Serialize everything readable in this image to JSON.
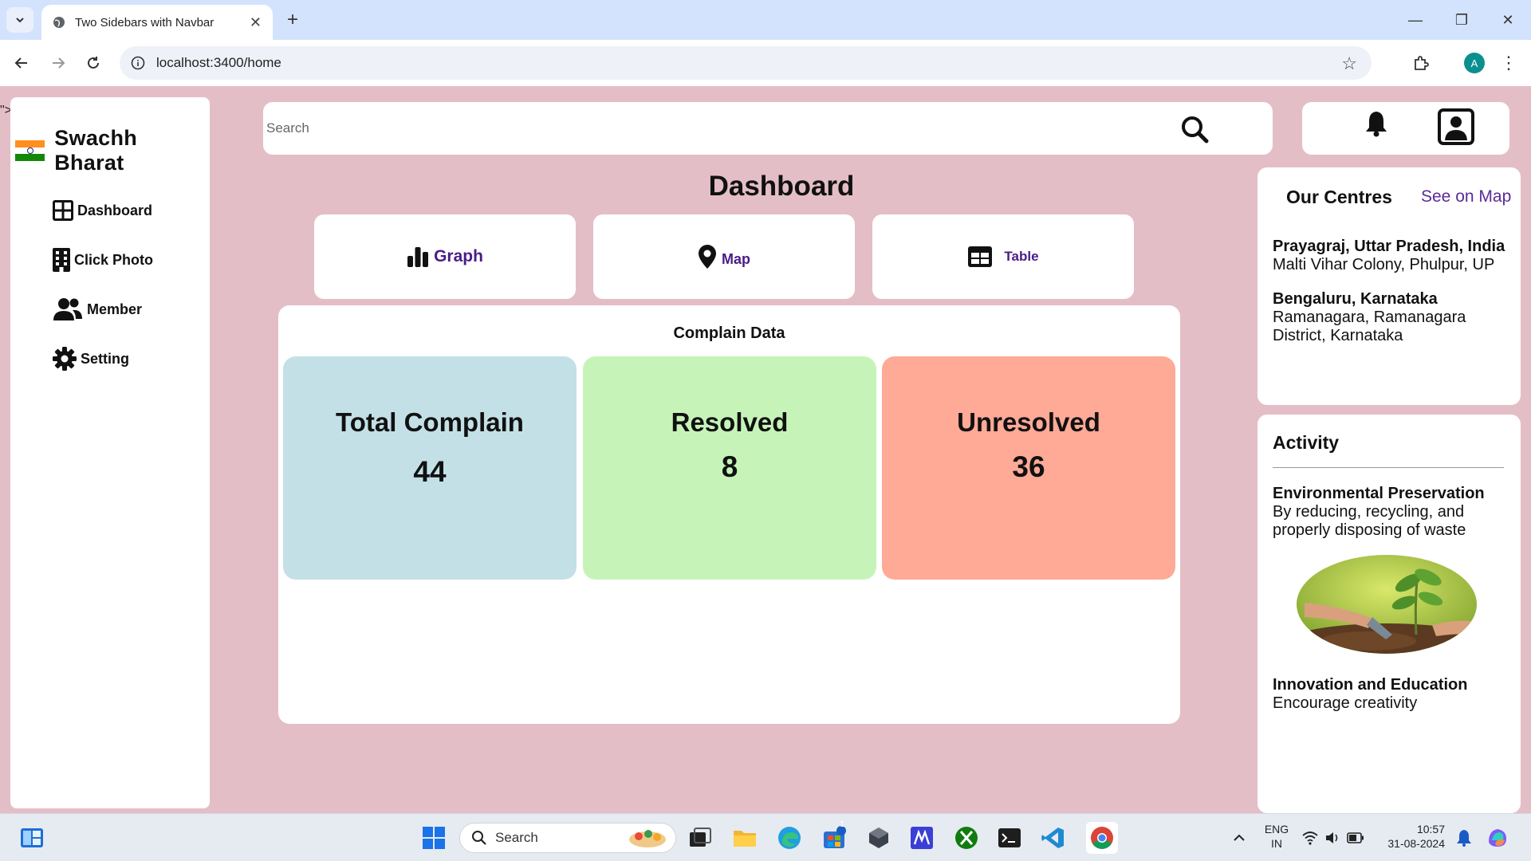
{
  "browser": {
    "tab_title": "Two Sidebars with Navbar",
    "url": "localhost:3400/home",
    "profile_initial": "A"
  },
  "stray_text": "\">",
  "sidebar": {
    "brand": "Swachh Bharat",
    "items": [
      {
        "label": "Dashboard",
        "icon": "grid-icon"
      },
      {
        "label": "Click Photo",
        "icon": "building-icon"
      },
      {
        "label": "Member",
        "icon": "users-icon"
      },
      {
        "label": "Setting",
        "icon": "gear-icon"
      }
    ]
  },
  "navbar": {
    "search_placeholder": "Search"
  },
  "main": {
    "title": "Dashboard",
    "views": [
      {
        "label": "Graph",
        "icon": "bar-chart-icon"
      },
      {
        "label": "Map",
        "icon": "map-pin-icon"
      },
      {
        "label": "Table",
        "icon": "table-icon"
      }
    ],
    "complain": {
      "title": "Complain Data",
      "stats": [
        {
          "label": "Total Complain",
          "value": "44",
          "color": "#c3e0e6"
        },
        {
          "label": "Resolved",
          "value": "8",
          "color": "#c6f4b8"
        },
        {
          "label": "Unresolved",
          "value": "36",
          "color": "#ffa997"
        }
      ]
    }
  },
  "centres": {
    "title": "Our Centres",
    "see_map": "See on Map",
    "items": [
      {
        "name": "Prayagraj, Uttar Pradesh, India",
        "address": "Malti Vihar Colony, Phulpur, UP"
      },
      {
        "name": "Bengaluru, Karnataka",
        "address": "Ramanagara, Ramanagara District, Karnataka"
      }
    ]
  },
  "activity": {
    "title": "Activity",
    "items": [
      {
        "name": "Environmental Preservation",
        "desc": "By reducing, recycling, and properly disposing of waste"
      },
      {
        "name": "Innovation and Education",
        "desc": "Encourage creativity"
      }
    ]
  },
  "taskbar": {
    "search": "Search",
    "lang_top": "ENG",
    "lang_bottom": "IN",
    "time": "10:57",
    "date": "31-08-2024",
    "store_badge": "1"
  },
  "colors": {
    "page_bg": "#e4bec7",
    "accent_purple": "#4a1c86",
    "link_purple": "#5b2a9a"
  }
}
